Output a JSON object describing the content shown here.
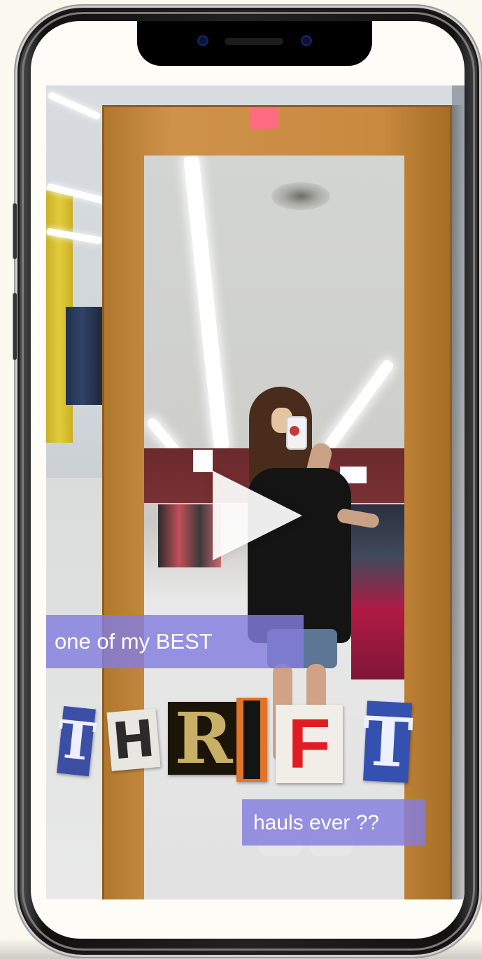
{
  "captions": {
    "line1": "one of my BEST",
    "line3": "hauls ever ??"
  },
  "ransom_letters": [
    "T",
    "H",
    "R",
    "I",
    "F",
    "T"
  ],
  "media": {
    "play_button": "play-icon"
  },
  "colors": {
    "caption_bg": "#847cde",
    "frame_wood": "#c78a3e",
    "page_bg": "#fbf8ef"
  }
}
